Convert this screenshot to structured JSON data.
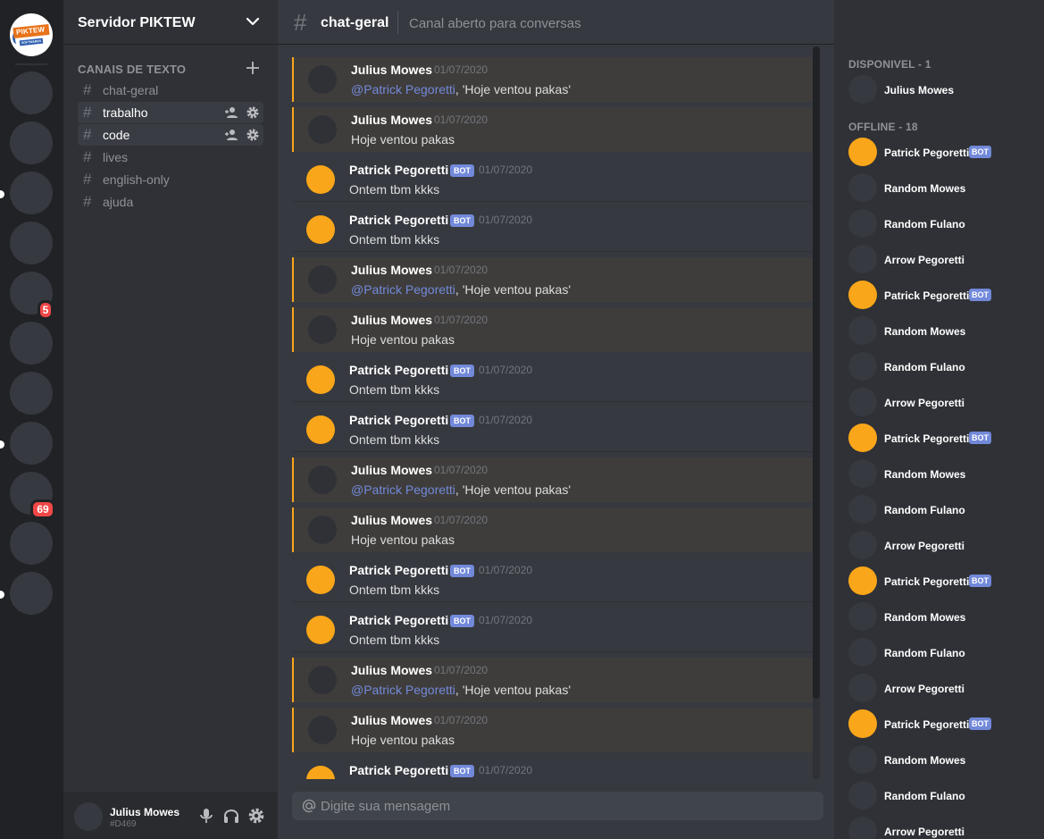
{
  "server": {
    "name": "Servidor PIKTEW",
    "logo_text": "PIKTEW",
    "logo_subtext": "SOFTWARES",
    "badges": [
      "5",
      "69"
    ]
  },
  "sidebar": {
    "category": "CANAIS DE TEXTO",
    "channels": [
      {
        "name": "chat-geral",
        "active": false
      },
      {
        "name": "trabalho",
        "active": true
      },
      {
        "name": "code",
        "active": true
      },
      {
        "name": "lives",
        "active": false
      },
      {
        "name": "english-only",
        "active": false
      },
      {
        "name": "ajuda",
        "active": false
      }
    ]
  },
  "user": {
    "name": "Julius Mowes",
    "tag": "#D469"
  },
  "channel": {
    "name": "chat-geral",
    "topic": "Canal aberto para conversas"
  },
  "messages": [
    {
      "author": "Julius Mowes",
      "date": "01/07/2020",
      "bot": false,
      "mention": "@Patrick Pegoretti",
      "text": ", 'Hoje ventou pakas'"
    },
    {
      "author": "Julius Mowes",
      "date": "01/07/2020",
      "bot": false,
      "mention": "",
      "text": "Hoje ventou pakas"
    },
    {
      "author": "Patrick Pegoretti",
      "date": "01/07/2020",
      "bot": true,
      "mention": "",
      "text": "Ontem tbm kkks"
    },
    {
      "author": "Patrick Pegoretti",
      "date": "01/07/2020",
      "bot": true,
      "mention": "",
      "text": "Ontem tbm kkks"
    },
    {
      "author": "Julius Mowes",
      "date": "01/07/2020",
      "bot": false,
      "mention": "@Patrick Pegoretti",
      "text": ", 'Hoje ventou pakas'"
    },
    {
      "author": "Julius Mowes",
      "date": "01/07/2020",
      "bot": false,
      "mention": "",
      "text": "Hoje ventou pakas"
    },
    {
      "author": "Patrick Pegoretti",
      "date": "01/07/2020",
      "bot": true,
      "mention": "",
      "text": "Ontem tbm kkks"
    },
    {
      "author": "Patrick Pegoretti",
      "date": "01/07/2020",
      "bot": true,
      "mention": "",
      "text": "Ontem tbm kkks"
    },
    {
      "author": "Julius Mowes",
      "date": "01/07/2020",
      "bot": false,
      "mention": "@Patrick Pegoretti",
      "text": ", 'Hoje ventou pakas'"
    },
    {
      "author": "Julius Mowes",
      "date": "01/07/2020",
      "bot": false,
      "mention": "",
      "text": "Hoje ventou pakas"
    },
    {
      "author": "Patrick Pegoretti",
      "date": "01/07/2020",
      "bot": true,
      "mention": "",
      "text": "Ontem tbm kkks"
    },
    {
      "author": "Patrick Pegoretti",
      "date": "01/07/2020",
      "bot": true,
      "mention": "",
      "text": "Ontem tbm kkks"
    },
    {
      "author": "Julius Mowes",
      "date": "01/07/2020",
      "bot": false,
      "mention": "@Patrick Pegoretti",
      "text": ", 'Hoje ventou pakas'"
    },
    {
      "author": "Julius Mowes",
      "date": "01/07/2020",
      "bot": false,
      "mention": "",
      "text": "Hoje ventou pakas"
    },
    {
      "author": "Patrick Pegoretti",
      "date": "01/07/2020",
      "bot": true,
      "mention": "",
      "text": ""
    }
  ],
  "composer": {
    "placeholder": "Digite sua mensagem"
  },
  "members": {
    "online_header": "DISPONIVEL - 1",
    "online": [
      {
        "name": "Julius Mowes",
        "bot": false
      }
    ],
    "offline_header": "OFFLINE - 18",
    "offline": [
      {
        "name": "Patrick Pegoretti",
        "bot": true
      },
      {
        "name": "Random Mowes",
        "bot": false
      },
      {
        "name": "Random Fulano",
        "bot": false
      },
      {
        "name": "Arrow Pegoretti",
        "bot": false
      },
      {
        "name": "Patrick Pegoretti",
        "bot": true
      },
      {
        "name": "Random Mowes",
        "bot": false
      },
      {
        "name": "Random Fulano",
        "bot": false
      },
      {
        "name": "Arrow Pegoretti",
        "bot": false
      },
      {
        "name": "Patrick Pegoretti",
        "bot": true
      },
      {
        "name": "Random Mowes",
        "bot": false
      },
      {
        "name": "Random Fulano",
        "bot": false
      },
      {
        "name": "Arrow Pegoretti",
        "bot": false
      },
      {
        "name": "Patrick Pegoretti",
        "bot": true
      },
      {
        "name": "Random Mowes",
        "bot": false
      },
      {
        "name": "Random Fulano",
        "bot": false
      },
      {
        "name": "Arrow Pegoretti",
        "bot": false
      },
      {
        "name": "Patrick Pegoretti",
        "bot": true
      },
      {
        "name": "Random Mowes",
        "bot": false
      },
      {
        "name": "Random Fulano",
        "bot": false
      },
      {
        "name": "Arrow Pegoretti",
        "bot": false
      }
    ]
  },
  "labels": {
    "bot_tag": "BOT"
  },
  "colors": {
    "accent": "#7289da",
    "mention_bar": "#faa61a",
    "bot_avatar": "#faa61a",
    "notification": "#f04747"
  },
  "icons": {
    "server_menu": "chevron-down-icon",
    "add_channel": "plus-icon",
    "invite": "add-member-icon",
    "settings": "gear-icon",
    "mic": "microphone-icon",
    "headset": "headphones-icon",
    "mention": "at-icon"
  }
}
